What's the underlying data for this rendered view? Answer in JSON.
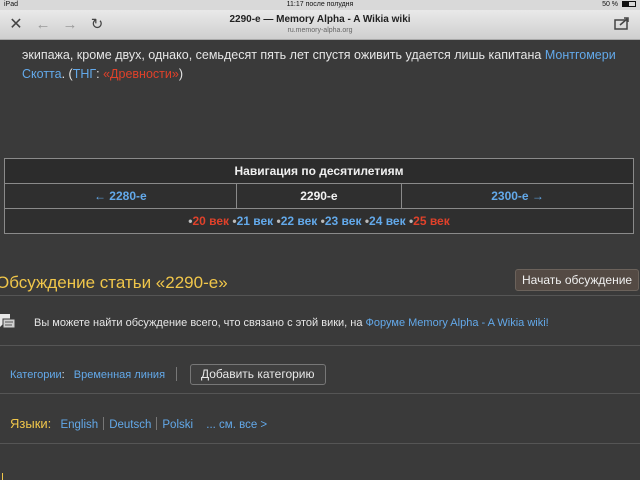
{
  "status_bar": {
    "device": "iPad",
    "time": "11:17 после полудня",
    "battery": "50 %"
  },
  "browser": {
    "title": "2290-е — Memory Alpha - A Wikia wiki",
    "url": "ru.memory-alpha.org"
  },
  "article": {
    "line1_text": "экипажа, кроме двух, однако, семьдесят пять лет спустя оживить удается лишь капитана ",
    "line1_link": "Монтгомери",
    "line2_link": "Скотта",
    "line2_mid": ". (",
    "line2_link2": "ТНГ",
    "line2_colon": ": ",
    "line2_redlink": "«Древности»",
    "line2_end": ")"
  },
  "navigation": {
    "header": "Навигация по десятилетиям",
    "prev": "← 2280-е",
    "current": "2290-е",
    "next": "2300-е →",
    "centuries": [
      {
        "label": "20 век",
        "red": true
      },
      {
        "label": "21 век",
        "red": false
      },
      {
        "label": "22 век",
        "red": false
      },
      {
        "label": "23 век",
        "red": false
      },
      {
        "label": "24 век",
        "red": false
      },
      {
        "label": "25 век",
        "red": true
      }
    ]
  },
  "discussion": {
    "title": "Обсуждение статьи «2290-е»",
    "start_button": "Начать обсуждение",
    "text": "Вы можете найти обсуждение всего, что связано с этой вики, на ",
    "forum_link": "Форуме Memory Alpha - A Wikia wiki!"
  },
  "categories": {
    "label": "Категории",
    "colon": ":",
    "items": [
      "Временная линия"
    ],
    "add_button": "Добавить категорию"
  },
  "languages": {
    "label": "Языки:",
    "items": [
      "English",
      "Deutsch",
      "Polski"
    ],
    "see_all": "... см. все >"
  },
  "colors": {
    "background": "#3a3a3a",
    "link": "#63a9ea",
    "redlink": "#e0412a",
    "heading": "#f0c64a"
  }
}
